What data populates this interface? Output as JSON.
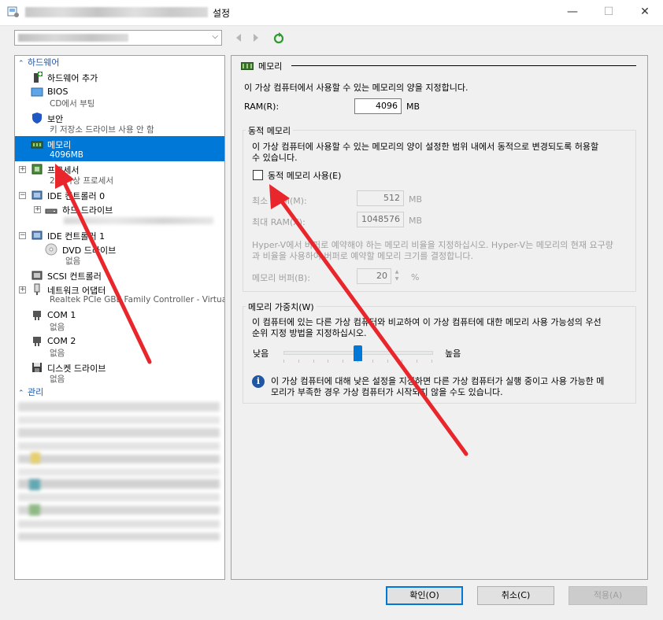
{
  "window": {
    "title": "설정",
    "minimize_label": "—",
    "maximize_label": "☐",
    "close_label": "✕"
  },
  "toolbar": {
    "combo_arrow": "⌵"
  },
  "sidebar": {
    "hardware_header": "하드웨어",
    "management_header": "관리",
    "items": [
      {
        "label": "하드웨어 추가",
        "sub": ""
      },
      {
        "label": "BIOS",
        "sub": "CD에서 부팅"
      },
      {
        "label": "보안",
        "sub": "키 저장소 드라이브 사용 안 함"
      },
      {
        "label": "메모리",
        "sub": "4096MB"
      },
      {
        "label": "프로세서",
        "sub": "2개 가상 프로세서"
      },
      {
        "label": "IDE 컨트롤러 0",
        "sub": ""
      },
      {
        "label": "하드 드라이브",
        "sub": ""
      },
      {
        "label": "IDE 컨트롤러 1",
        "sub": ""
      },
      {
        "label": "DVD 드라이브",
        "sub": "없음"
      },
      {
        "label": "SCSI 컨트롤러",
        "sub": ""
      },
      {
        "label": "네트워크 어댑터",
        "sub": "Realtek PCIe GBE Family Controller - Virtua..."
      },
      {
        "label": "COM 1",
        "sub": "없음"
      },
      {
        "label": "COM 2",
        "sub": "없음"
      },
      {
        "label": "디스켓 드라이브",
        "sub": "없음"
      }
    ]
  },
  "memory": {
    "title": "메모리",
    "description": "이 가상 컴퓨터에서 사용할 수 있는 메모리의 양을 지정합니다.",
    "ram_label": "RAM(R):",
    "ram_value": "4096",
    "unit_mb": "MB",
    "dynamic": {
      "title": "동적 메모리",
      "desc_line1": "이 가상 컴퓨터에 사용할 수 있는 메모리의 양이 설정한 범위 내에서 동적으로 변경되도록 허용할",
      "desc_line2": "수 있습니다.",
      "enable_label": "동적 메모리 사용(E)",
      "min_label": "최소 RAM(M):",
      "min_value": "512",
      "max_label": "최대 RAM(X):",
      "max_value": "1048576",
      "buffer_desc_line1": "Hyper-V에서 버퍼로 예약해야 하는 메모리 비율을 지정하십시오. Hyper-V는 메모리의 현재 요구량",
      "buffer_desc_line2": "과 비율을 사용하여 버퍼로 예약할 메모리 크기를 결정합니다.",
      "buffer_label": "메모리 버퍼(B):",
      "buffer_value": "20",
      "percent": "%"
    },
    "weight": {
      "title": "메모리 가중치(W)",
      "desc_line1": "이 컴퓨터에 있는 다른 가상 컴퓨터와 비교하여 이 가상 컴퓨터에 대한 메모리 사용 가능성의 우선",
      "desc_line2": "순위 지정 방법을 지정하십시오.",
      "low_label": "낮음",
      "high_label": "높음",
      "slider_fraction": 0.5,
      "info_line1": "이 가상 컴퓨터에 대해 낮은 설정을 지정하면 다른 가상 컴퓨터가 실행 중이고 사용 가능한 메",
      "info_line2": "모리가 부족한 경우 가상 컴퓨터가 시작되지 않을 수도 있습니다."
    }
  },
  "buttons": {
    "ok": "확인(O)",
    "cancel": "취소(C)",
    "apply": "적용(A)"
  },
  "colors": {
    "selection": "#0078d7",
    "section_header": "#1f57a4",
    "annotation_arrow": "#e8262b"
  }
}
